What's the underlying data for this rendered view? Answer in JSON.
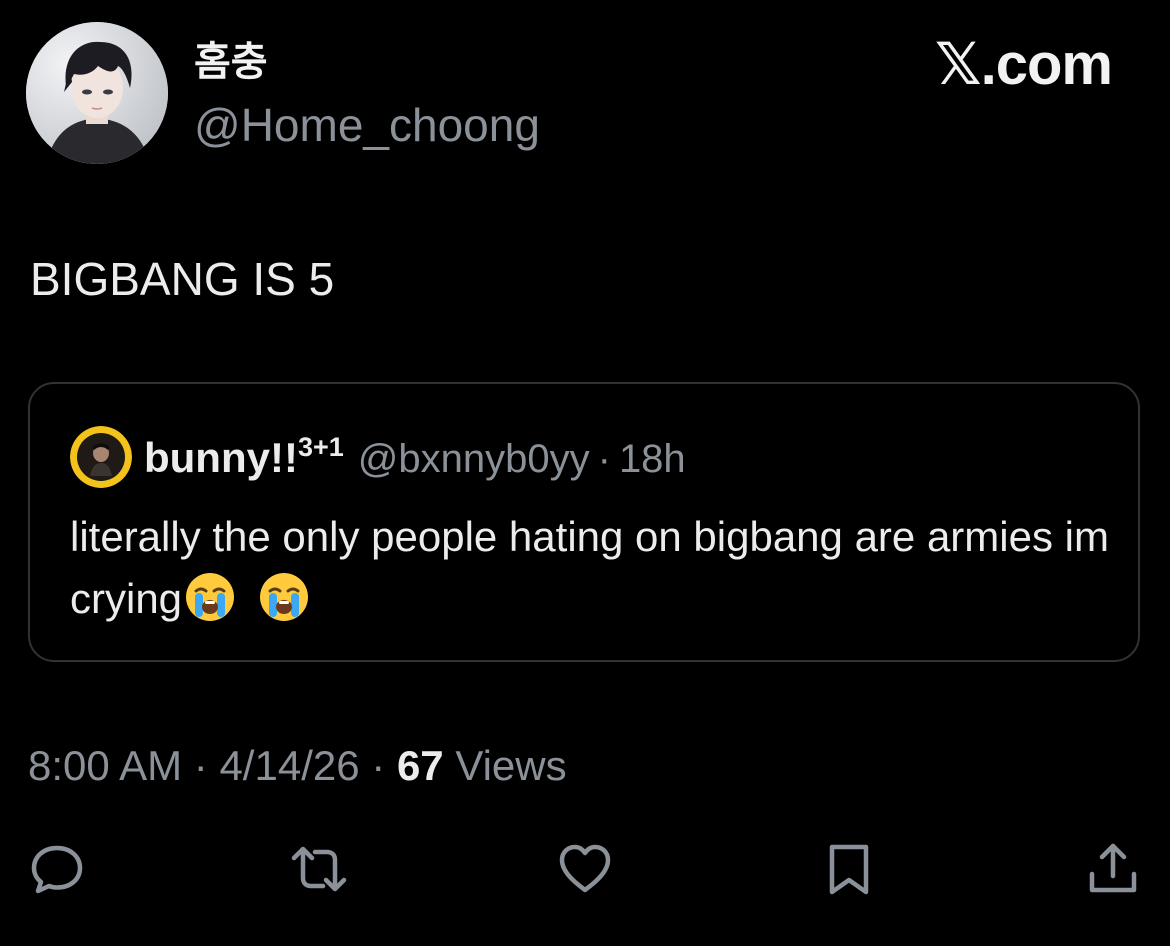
{
  "author": {
    "display_name": "홈충",
    "handle": "@Home_choong",
    "avatar_icon": "avatar-anime-portrait-icon"
  },
  "brand": {
    "label": "𝕏.com"
  },
  "tweet": {
    "text": "BIGBANG IS 5"
  },
  "quote": {
    "display_name": "bunny!!",
    "name_superscript": "3+1",
    "handle": "@bxnnyb0yy",
    "separator": "·",
    "time": "18h",
    "text": "literally the only people hating on bigbang are armies im crying",
    "emojis": [
      "loudly-crying-face",
      "loudly-crying-face"
    ]
  },
  "meta": {
    "time": "8:00 AM",
    "separator": "·",
    "date": "4/14/26",
    "views_count": "67",
    "views_label": "Views"
  },
  "actions": [
    "reply-icon",
    "retweet-icon",
    "like-icon",
    "bookmark-icon",
    "share-icon"
  ],
  "colors": {
    "background": "#000000",
    "primary_text": "#e7e9ea",
    "secondary_text": "#8b9198",
    "border": "#2f3336"
  }
}
